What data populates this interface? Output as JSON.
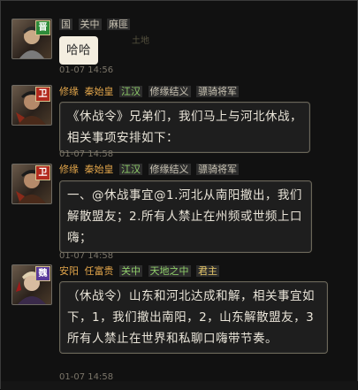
{
  "messages": [
    {
      "badge": "晋",
      "badge_color": "#2e8b3a",
      "meta": {
        "a": "国",
        "b": "关中",
        "c": "麻匪"
      },
      "text": "哈哈",
      "time": "01-07 14:56"
    },
    {
      "badge": "卫",
      "badge_color": "#b22a1e",
      "meta": {
        "name": "修缘",
        "b": "秦始皇",
        "c": "江汉",
        "d": "修缘结义",
        "e": "骠骑将军"
      },
      "text": "《休战令》兄弟们，我们马上与河北休战，相关事项安排如下：",
      "time": "01-07 14:58"
    },
    {
      "badge": "卫",
      "badge_color": "#b22a1e",
      "meta": {
        "name": "修缘",
        "b": "秦始皇",
        "c": "江汉",
        "d": "修缘结义",
        "e": "骠骑将军"
      },
      "text": "一、@休战事宜@1.河北从南阳撤出，我们解散盟友；2.所有人禁止在州频或世频上口嗨；",
      "time": "01-07 14:58"
    },
    {
      "badge": "魏",
      "badge_color": "#5a3a9a",
      "meta": {
        "name": "安阳",
        "b": "任富贵",
        "c": "关中",
        "d": "天地之中",
        "e": "君主"
      },
      "text": "（休战令）山东和河北达成和解，相关事宜如下，1，我们撤出南阳，2，山东解散盟友，3所有人禁止在世界和私聊口嗨带节奏。",
      "time": "01-07 14:58"
    }
  ],
  "overlay": {
    "sub": "土地",
    "label": "土地"
  }
}
